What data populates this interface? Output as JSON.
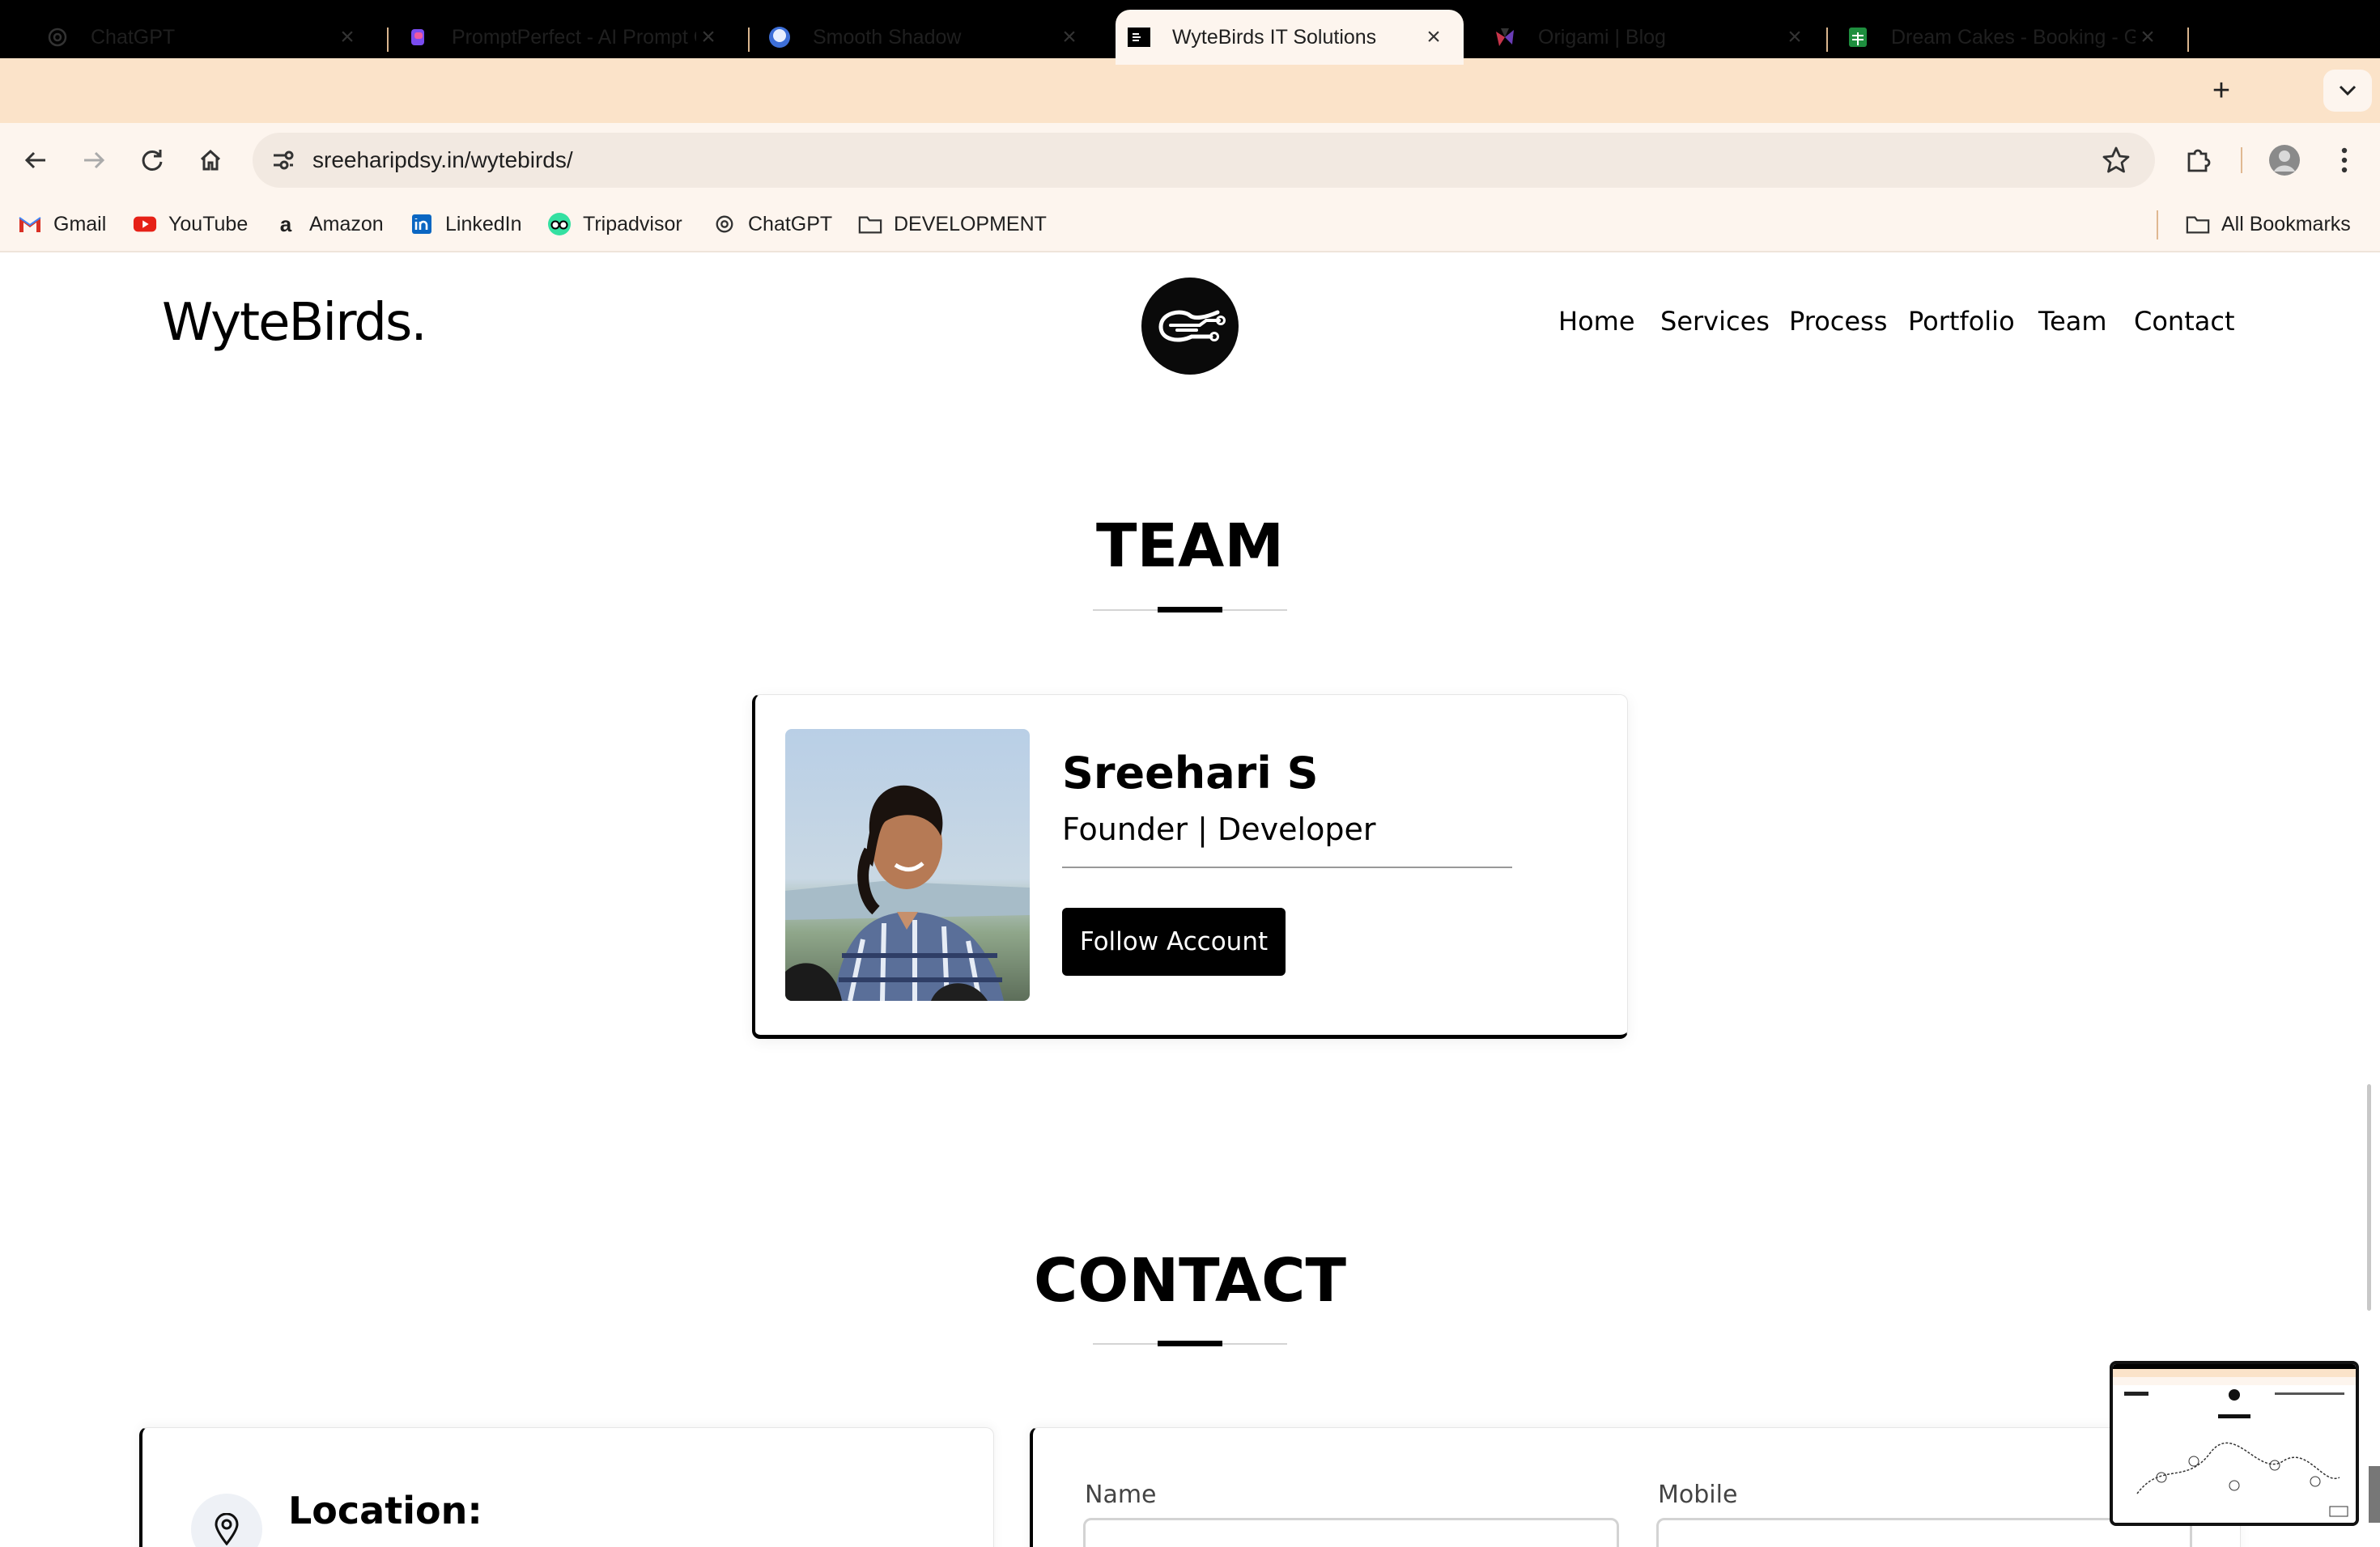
{
  "browser": {
    "tabs": [
      {
        "title": "ChatGPT",
        "icon": "openai-icon"
      },
      {
        "title": "PromptPerfect - AI Prompt Generator",
        "icon": "promptperfect-icon"
      },
      {
        "title": "Smooth Shadow",
        "icon": "smooth-shadow-icon"
      },
      {
        "title": "WyteBirds IT Solutions",
        "icon": "wytebirds-icon",
        "active": true
      },
      {
        "title": "Origami | Blog",
        "icon": "origami-icon"
      },
      {
        "title": "Dream Cakes - Booking - Google Sheets",
        "icon": "sheets-icon"
      }
    ],
    "new_tab": "+",
    "url": "sreeharipdsy.in/wytebirds/",
    "bookmarks": [
      {
        "label": "Gmail",
        "icon": "gmail-icon"
      },
      {
        "label": "YouTube",
        "icon": "youtube-icon"
      },
      {
        "label": "Amazon",
        "icon": "amazon-icon"
      },
      {
        "label": "LinkedIn",
        "icon": "linkedin-icon"
      },
      {
        "label": "Tripadvisor",
        "icon": "tripadvisor-icon"
      },
      {
        "label": "ChatGPT",
        "icon": "openai-icon"
      },
      {
        "label": "DEVELOPMENT",
        "icon": "folder-icon"
      }
    ],
    "all_bookmarks": "All Bookmarks"
  },
  "site": {
    "brand": "WyteBirds.",
    "nav": [
      "Home",
      "Services",
      "Process",
      "Portfolio",
      "Team",
      "Contact"
    ]
  },
  "team": {
    "heading": "TEAM",
    "member": {
      "name": "Sreehari S",
      "role": "Founder | Developer",
      "button": "Follow Account"
    }
  },
  "contact": {
    "heading": "CONTACT",
    "location_title": "Location:",
    "fields": {
      "name_label": "Name",
      "mobile_label": "Mobile"
    }
  },
  "colors": {
    "tabstrip": "#fbe3c9",
    "toolbar": "#fdf5ee",
    "accent": "#000000"
  }
}
